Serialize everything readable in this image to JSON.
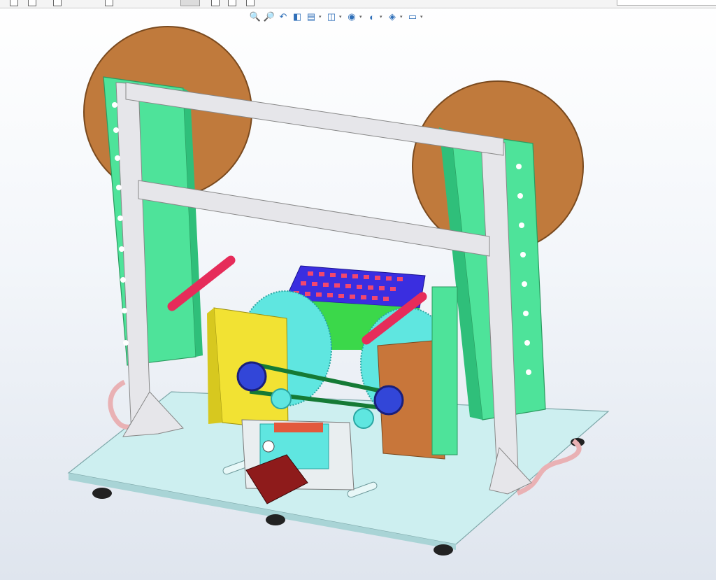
{
  "window": {
    "background_top": "#ffffff",
    "background_bottom": "#dfe5ee"
  },
  "toolbar": {
    "buttons": [
      "grid-icon",
      "page-icon",
      "copy-icon",
      "monitor-icon",
      "scissors-icon",
      "star-icon",
      "document-icon",
      "gear-icon"
    ],
    "selected": "scissors-icon"
  },
  "heads_up_view": {
    "items": [
      {
        "icon": "zoom-to-fit-icon",
        "glyph": "🔍",
        "dropdown": false
      },
      {
        "icon": "zoom-to-area-icon",
        "glyph": "🔎",
        "dropdown": false
      },
      {
        "icon": "previous-view-icon",
        "glyph": "↶",
        "dropdown": false
      },
      {
        "icon": "section-view-icon",
        "glyph": "◧",
        "dropdown": false
      },
      {
        "icon": "dynamic-annotation-icon",
        "glyph": "▤",
        "dropdown": true
      },
      {
        "icon": "view-orientation-icon",
        "glyph": "◫",
        "dropdown": true
      },
      {
        "icon": "display-style-icon",
        "glyph": "◉",
        "dropdown": true
      },
      {
        "icon": "hide-show-items-icon",
        "glyph": "◐",
        "dropdown": true
      },
      {
        "icon": "edit-appearance-icon",
        "glyph": "◈",
        "dropdown": true
      },
      {
        "icon": "view-settings-icon",
        "glyph": "▭",
        "dropdown": true
      }
    ]
  },
  "model": {
    "part_colors": {
      "aluminum_frame": "#e6e6ea",
      "side_plates": "#4ee39a",
      "reels": "#c07a3c",
      "yellow_block": "#f2e233",
      "orange_block": "#c8763a",
      "gear": "#5fe6e0",
      "tray": "#3a2ee0",
      "tray_cells": "#f2476e",
      "rods": "#e62c5a",
      "motor": "#8e1b1b",
      "base_plate": "#cdeff0",
      "feet": "#222222",
      "hose": "#e9b1b4"
    }
  }
}
